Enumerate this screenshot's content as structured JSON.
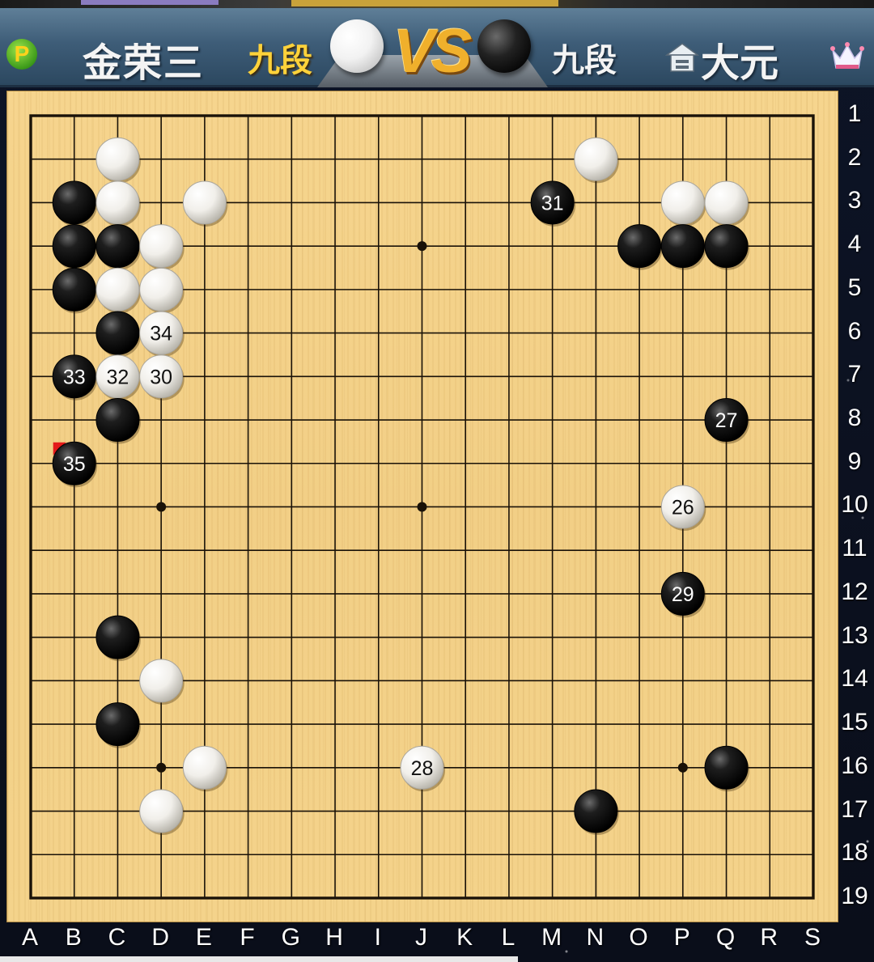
{
  "header": {
    "left_player_name": "金荣三",
    "left_player_rank": "九段",
    "vs_label": "VS",
    "right_player_rank": "九段",
    "right_player_name": "大元",
    "p_badge": "P",
    "left_player_color": "white",
    "right_player_color": "black"
  },
  "board": {
    "size": 19,
    "column_labels": [
      "A",
      "B",
      "C",
      "D",
      "E",
      "F",
      "G",
      "H",
      "I",
      "J",
      "K",
      "L",
      "M",
      "N",
      "O",
      "P",
      "Q",
      "R",
      "S"
    ],
    "row_labels": [
      "1",
      "2",
      "3",
      "4",
      "5",
      "6",
      "7",
      "8",
      "9",
      "10",
      "11",
      "12",
      "13",
      "14",
      "15",
      "16",
      "17",
      "18",
      "19"
    ],
    "star_points": [
      [
        "D",
        4
      ],
      [
        "J",
        4
      ],
      [
        "P",
        4
      ],
      [
        "D",
        10
      ],
      [
        "J",
        10
      ],
      [
        "P",
        10
      ],
      [
        "D",
        16
      ],
      [
        "J",
        16
      ],
      [
        "P",
        16
      ]
    ],
    "last_move_marker": {
      "col": "B",
      "row": 9,
      "color": "#e41a1a"
    },
    "stones": [
      {
        "col": "C",
        "row": 2,
        "color": "white"
      },
      {
        "col": "E",
        "row": 3,
        "color": "white"
      },
      {
        "col": "N",
        "row": 2,
        "color": "white"
      },
      {
        "col": "P",
        "row": 3,
        "color": "white"
      },
      {
        "col": "Q",
        "row": 3,
        "color": "white"
      },
      {
        "col": "B",
        "row": 3,
        "color": "black"
      },
      {
        "col": "C",
        "row": 3,
        "color": "white"
      },
      {
        "col": "M",
        "row": 3,
        "color": "black",
        "label": "31"
      },
      {
        "col": "B",
        "row": 4,
        "color": "black"
      },
      {
        "col": "C",
        "row": 4,
        "color": "black"
      },
      {
        "col": "D",
        "row": 4,
        "color": "white"
      },
      {
        "col": "O",
        "row": 4,
        "color": "black"
      },
      {
        "col": "P",
        "row": 4,
        "color": "black"
      },
      {
        "col": "Q",
        "row": 4,
        "color": "black"
      },
      {
        "col": "B",
        "row": 5,
        "color": "black"
      },
      {
        "col": "C",
        "row": 5,
        "color": "white"
      },
      {
        "col": "D",
        "row": 5,
        "color": "white"
      },
      {
        "col": "C",
        "row": 6,
        "color": "black"
      },
      {
        "col": "D",
        "row": 6,
        "color": "white",
        "label": "34"
      },
      {
        "col": "B",
        "row": 7,
        "color": "black",
        "label": "33"
      },
      {
        "col": "C",
        "row": 7,
        "color": "white",
        "label": "32"
      },
      {
        "col": "D",
        "row": 7,
        "color": "white",
        "label": "30"
      },
      {
        "col": "C",
        "row": 8,
        "color": "black"
      },
      {
        "col": "Q",
        "row": 8,
        "color": "black",
        "label": "27"
      },
      {
        "col": "B",
        "row": 9,
        "color": "black",
        "label": "35"
      },
      {
        "col": "P",
        "row": 10,
        "color": "white",
        "label": "26"
      },
      {
        "col": "P",
        "row": 12,
        "color": "black",
        "label": "29"
      },
      {
        "col": "C",
        "row": 13,
        "color": "black"
      },
      {
        "col": "D",
        "row": 14,
        "color": "white"
      },
      {
        "col": "C",
        "row": 15,
        "color": "black"
      },
      {
        "col": "E",
        "row": 16,
        "color": "white"
      },
      {
        "col": "J",
        "row": 16,
        "color": "white",
        "label": "28"
      },
      {
        "col": "Q",
        "row": 16,
        "color": "black"
      },
      {
        "col": "D",
        "row": 17,
        "color": "white"
      },
      {
        "col": "N",
        "row": 17,
        "color": "black"
      }
    ]
  }
}
